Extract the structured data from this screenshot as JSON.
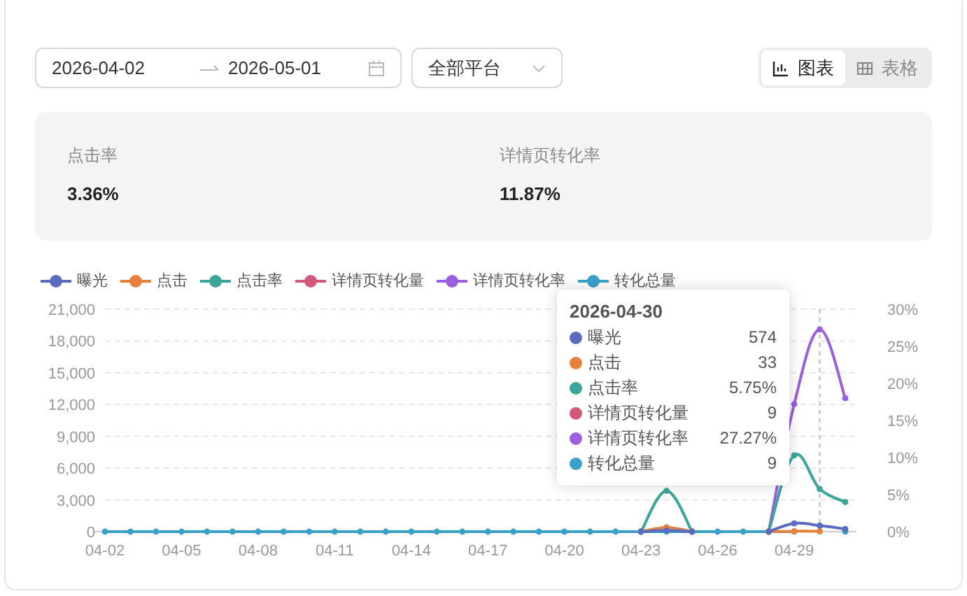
{
  "filters": {
    "date_start": "2026-04-02",
    "date_end": "2026-05-01",
    "platform": "全部平台"
  },
  "view_toggle": [
    {
      "label": "图表",
      "kind": "chart",
      "selected": true
    },
    {
      "label": "表格",
      "kind": "table",
      "selected": false
    }
  ],
  "stats": [
    {
      "label": "点击率",
      "value": "3.36%"
    },
    {
      "label": "详情页转化率",
      "value": "11.87%"
    }
  ],
  "chart": {
    "chart_data": {
      "type": "line",
      "grid": true,
      "legend": true,
      "categories": [
        "04-02",
        null,
        null,
        "04-05",
        null,
        null,
        "04-08",
        null,
        null,
        "04-11",
        null,
        null,
        "04-14",
        null,
        null,
        "04-17",
        null,
        null,
        "04-20",
        null,
        null,
        "04-23",
        null,
        null,
        "04-26",
        null,
        null,
        "04-29",
        null,
        null
      ],
      "ylim": [
        0,
        21000
      ],
      "yticks": [
        {
          "value": 0,
          "label": "0"
        },
        {
          "value": 3000,
          "label": "3,000"
        },
        {
          "value": 6000,
          "label": "6,000"
        },
        {
          "value": 9000,
          "label": "9,000"
        },
        {
          "value": 12000,
          "label": "12,000"
        },
        {
          "value": 15000,
          "label": "15,000"
        },
        {
          "value": 18000,
          "label": "18,000"
        },
        {
          "value": 21000,
          "label": "21,000"
        }
      ],
      "y2lim": [
        0,
        30
      ],
      "y2ticks": [
        {
          "value": 0,
          "label": "0%"
        },
        {
          "value": 5,
          "label": "5%"
        },
        {
          "value": 10,
          "label": "10%"
        },
        {
          "value": 15,
          "label": "15%"
        },
        {
          "value": 20,
          "label": "20%"
        },
        {
          "value": 25,
          "label": "25%"
        },
        {
          "value": 30,
          "label": "30%"
        }
      ],
      "series": [
        {
          "name": "曝光",
          "color": "#5b6bc0",
          "marker": "circle",
          "values": [
            null,
            null,
            null,
            null,
            null,
            null,
            null,
            null,
            null,
            null,
            null,
            null,
            null,
            null,
            null,
            null,
            null,
            null,
            null,
            null,
            null,
            0,
            120,
            0,
            null,
            null,
            0,
            780,
            574,
            250
          ]
        },
        {
          "name": "点击",
          "color": "#e8803c",
          "marker": "circle",
          "values": [
            null,
            null,
            null,
            null,
            null,
            null,
            null,
            null,
            null,
            null,
            null,
            null,
            null,
            null,
            null,
            null,
            null,
            null,
            null,
            null,
            null,
            0,
            400,
            0,
            null,
            null,
            0,
            40,
            33,
            null
          ]
        },
        {
          "name": "点击率",
          "color": "#3ba59a",
          "marker": "circle",
          "axis": "y2",
          "values": [
            null,
            null,
            null,
            null,
            null,
            null,
            null,
            null,
            null,
            null,
            null,
            null,
            null,
            null,
            null,
            null,
            null,
            null,
            null,
            null,
            null,
            0,
            5.5,
            0,
            null,
            null,
            0,
            10.3,
            5.75,
            4
          ]
        },
        {
          "name": "详情页转化量",
          "color": "#d4587a",
          "values": [
            null,
            null,
            null,
            null,
            null,
            null,
            null,
            null,
            null,
            null,
            null,
            null,
            null,
            null,
            null,
            null,
            null,
            null,
            null,
            null,
            null,
            null,
            null,
            null,
            null,
            null,
            null,
            null,
            null,
            null
          ]
        },
        {
          "name": "详情页转化率",
          "color": "#9c5fe0",
          "marker": "circle",
          "axis": "y2",
          "values": [
            null,
            null,
            null,
            null,
            null,
            null,
            null,
            null,
            null,
            null,
            null,
            null,
            null,
            null,
            null,
            null,
            null,
            null,
            null,
            null,
            null,
            0,
            null,
            0,
            null,
            null,
            0,
            17.2,
            27.27,
            18
          ]
        },
        {
          "name": "转化总量",
          "color": "#3aa0c8",
          "marker": "circle",
          "values": [
            0,
            0,
            0,
            0,
            0,
            0,
            0,
            0,
            0,
            0,
            0,
            0,
            0,
            0,
            0,
            0,
            0,
            0,
            0,
            0,
            0,
            0,
            0,
            0,
            0,
            0,
            0,
            0,
            null,
            0
          ]
        }
      ]
    },
    "tooltip": {
      "title": "2026-04-30",
      "rows": [
        {
          "name": "曝光",
          "value": "574"
        },
        {
          "name": "点击",
          "value": "33"
        },
        {
          "name": "点击率",
          "value": "5.75%"
        },
        {
          "name": "详情页转化量",
          "value": "9"
        },
        {
          "name": "详情页转化率",
          "value": "27.27%"
        },
        {
          "name": "转化总量",
          "value": "9"
        }
      ]
    }
  }
}
